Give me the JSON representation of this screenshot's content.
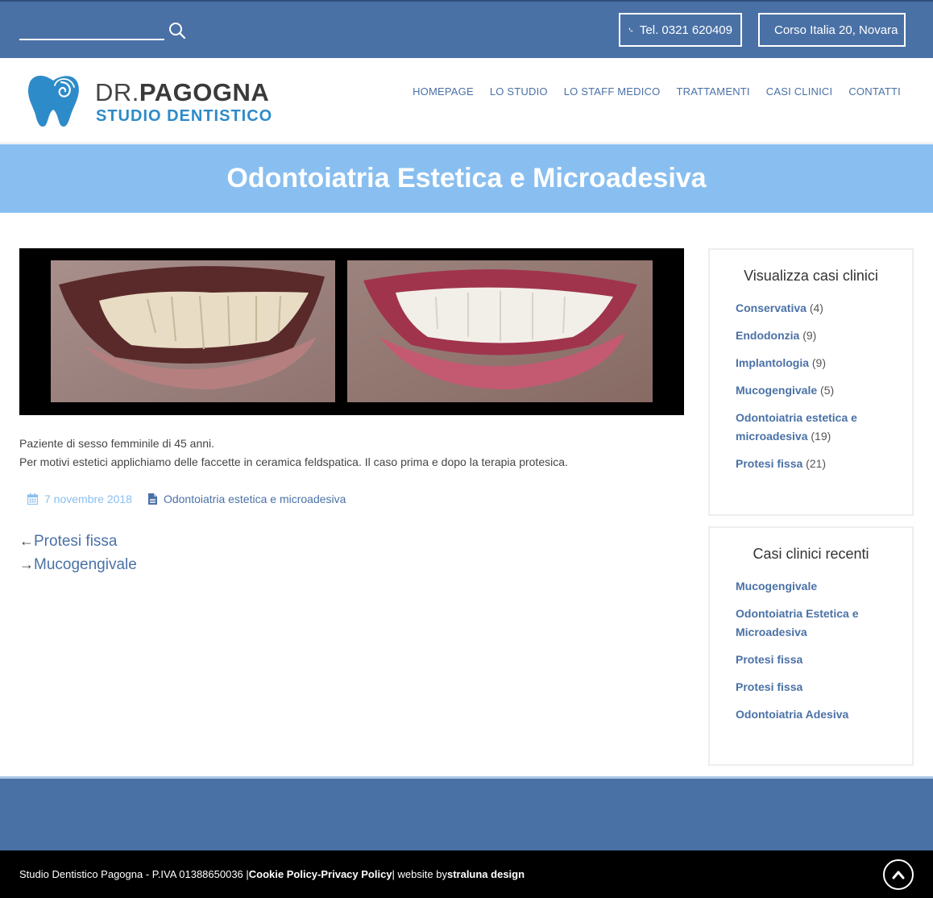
{
  "topbar": {
    "search": {
      "placeholder": "",
      "value": ""
    },
    "phone": "Tel. 0321 620409",
    "address": "Corso Italia 20, Novara"
  },
  "logo": {
    "name_light": "DR.",
    "name_bold": "PAGOGNA",
    "subtitle": "STUDIO DENTISTICO"
  },
  "nav": {
    "items": [
      {
        "label": "HOMEPAGE"
      },
      {
        "label": "LO STUDIO"
      },
      {
        "label": "LO STAFF MEDICO"
      },
      {
        "label": "TRATTAMENTI"
      },
      {
        "label": "CASI CLINICI"
      },
      {
        "label": "CONTATTI"
      }
    ]
  },
  "page_title": "Odontoiatria Estetica e Microadesiva",
  "post": {
    "desc_line1": "Paziente di sesso femminile di 45 anni.",
    "desc_line2": "Per motivi estetici applichiamo delle faccette in ceramica feldspatica. Il caso prima e dopo la terapia protesica.",
    "date": "7 novembre 2018",
    "category": "Odontoiatria estetica e microadesiva",
    "prev_arrow": "←",
    "prev_label": "Protesi fissa",
    "next_arrow": "→",
    "next_label": "Mucogengivale"
  },
  "sidebar": {
    "categories": {
      "title": "Visualizza casi clinici",
      "items": [
        {
          "label": "Conservativa",
          "count": "(4)"
        },
        {
          "label": "Endodonzia",
          "count": "(9)"
        },
        {
          "label": "Implantologia",
          "count": "(9)"
        },
        {
          "label": "Mucogengivale",
          "count": "(5)"
        },
        {
          "label": "Odontoiatria estetica e microadesiva",
          "count": "(19)"
        },
        {
          "label": "Protesi fissa",
          "count": "(21)"
        }
      ]
    },
    "recent": {
      "title": "Casi clinici recenti",
      "items": [
        {
          "label": "Mucogengivale"
        },
        {
          "label": "Odontoiatria Estetica e Microadesiva"
        },
        {
          "label": "Protesi fissa"
        },
        {
          "label": "Protesi fissa"
        },
        {
          "label": "Odontoiatria Adesiva"
        }
      ]
    }
  },
  "footer": {
    "company": "Studio Dentistico Pagogna - P.IVA 01388650036 | ",
    "cookie": "Cookie Policy",
    "sep": " - ",
    "privacy": "Privacy Policy",
    "website_by": " | website by ",
    "designer": "straluna design"
  },
  "colors": {
    "topbar": "#4a71a6",
    "title_band": "#89bff0",
    "link": "#4a71a6",
    "logo_blue": "#2e8bc9"
  }
}
